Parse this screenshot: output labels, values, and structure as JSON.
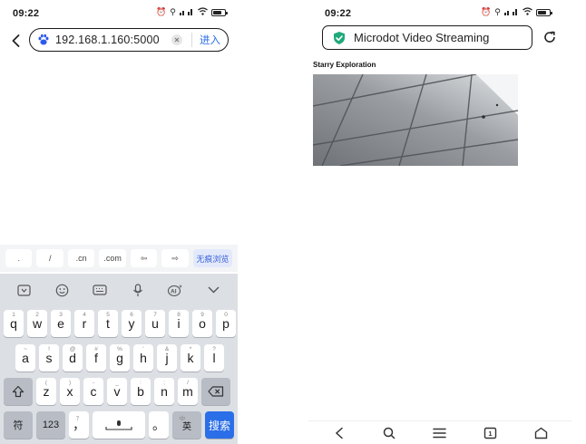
{
  "left": {
    "status": {
      "time": "09:22"
    },
    "browser": {
      "url_value": "192.168.1.160:5000",
      "go_label": "进入"
    },
    "shortcuts": [
      ".",
      "/",
      ".cn",
      ".com",
      "⇦",
      "⇨",
      "无痕浏览"
    ],
    "keyboard": {
      "row1": [
        {
          "k": "q",
          "s": "1"
        },
        {
          "k": "w",
          "s": "2"
        },
        {
          "k": "e",
          "s": "3"
        },
        {
          "k": "r",
          "s": "4"
        },
        {
          "k": "t",
          "s": "5"
        },
        {
          "k": "y",
          "s": "6"
        },
        {
          "k": "u",
          "s": "7"
        },
        {
          "k": "i",
          "s": "8"
        },
        {
          "k": "o",
          "s": "9"
        },
        {
          "k": "p",
          "s": "0"
        }
      ],
      "row2": [
        {
          "k": "a",
          "s": "~"
        },
        {
          "k": "s",
          "s": "!"
        },
        {
          "k": "d",
          "s": "@"
        },
        {
          "k": "f",
          "s": "#"
        },
        {
          "k": "g",
          "s": "%"
        },
        {
          "k": "h",
          "s": "'"
        },
        {
          "k": "j",
          "s": "&"
        },
        {
          "k": "k",
          "s": "*"
        },
        {
          "k": "l",
          "s": "?"
        }
      ],
      "row3": [
        {
          "k": "z",
          "s": "("
        },
        {
          "k": "x",
          "s": ")"
        },
        {
          "k": "c",
          "s": "-"
        },
        {
          "k": "v",
          "s": "_"
        },
        {
          "k": "b",
          "s": ":"
        },
        {
          "k": "n",
          "s": ";"
        },
        {
          "k": "m",
          "s": "/"
        }
      ],
      "symbol_key": "符",
      "num_key": "123",
      "comma_key": "，",
      "comma_sup": "？",
      "period_key": "。",
      "lang_key": "英",
      "lang_sup": "中",
      "search_key": "搜索"
    }
  },
  "right": {
    "status": {
      "time": "09:22"
    },
    "browser": {
      "page_title": "Microdot Video Streaming"
    },
    "page": {
      "heading": "Starry Exploration"
    }
  },
  "colors": {
    "accent": "#2a6ee8",
    "shield": "#1fa97a",
    "keyboard_bg": "#dcdfe4"
  }
}
